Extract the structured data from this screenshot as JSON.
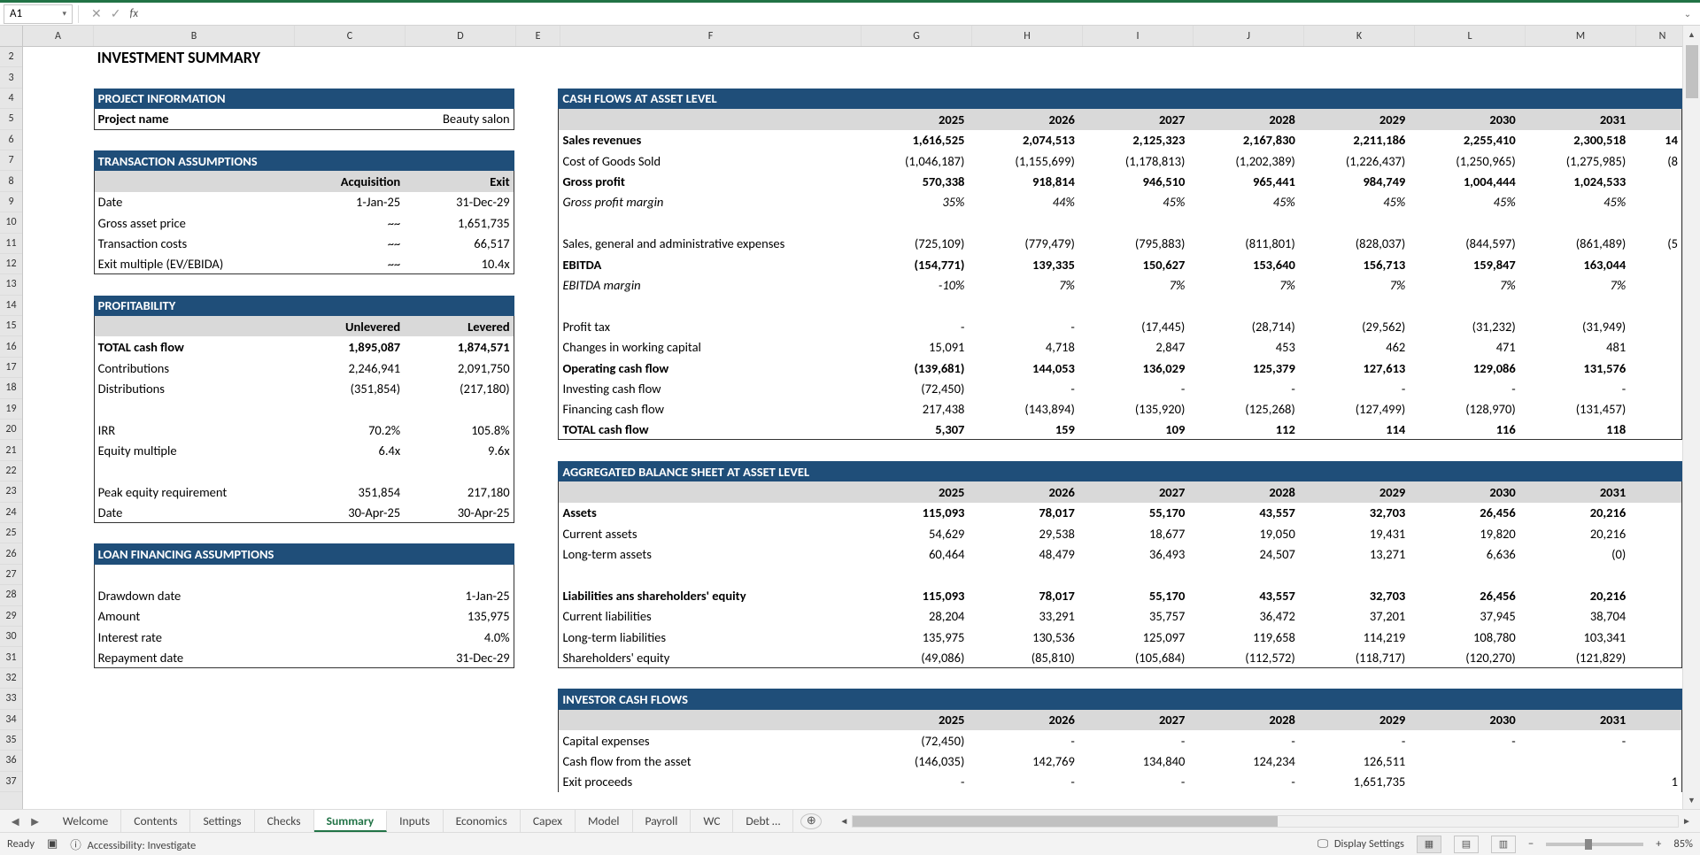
{
  "namebox": "A1",
  "page_title": "INVESTMENT SUMMARY",
  "columns": [
    "A",
    "B",
    "C",
    "D",
    "E",
    "F",
    "G",
    "H",
    "I",
    "J",
    "K",
    "L",
    "M",
    "N"
  ],
  "row_numbers": [
    "2",
    "3",
    "4",
    "5",
    "6",
    "7",
    "8",
    "9",
    "10",
    "11",
    "12",
    "13",
    "14",
    "15",
    "16",
    "17",
    "18",
    "19",
    "20",
    "21",
    "22",
    "23",
    "24",
    "25",
    "26",
    "27",
    "28",
    "29",
    "30",
    "31",
    "32",
    "33",
    "34",
    "35",
    "36",
    "37"
  ],
  "left": {
    "proj_info_hdr": "PROJECT INFORMATION",
    "proj_name_label": "Project name",
    "proj_name_value": "Beauty salon",
    "trans_hdr": "TRANSACTION ASSUMPTIONS",
    "acq_label": "Acquisition",
    "exit_label": "Exit",
    "rows1": [
      {
        "label": "Date",
        "acq": "1-Jan-25",
        "exit": "31-Dec-29"
      },
      {
        "label": "Gross asset price",
        "acq": "~~",
        "exit": "1,651,735"
      },
      {
        "label": "Transaction costs",
        "acq": "~~",
        "exit": "66,517"
      },
      {
        "label": "Exit multiple (EV/EBIDA)",
        "acq": "~~",
        "exit": "10.4x"
      }
    ],
    "profit_hdr": "PROFITABILITY",
    "unlev_label": "Unlevered",
    "lev_label": "Levered",
    "total_cf_label": "TOTAL cash flow",
    "total_cf_u": "1,895,087",
    "total_cf_l": "1,874,571",
    "contrib_label": " Contributions",
    "contrib_u": "2,246,941",
    "contrib_l": "2,091,750",
    "distrib_label": " Distributions",
    "distrib_u": "(351,854)",
    "distrib_l": "(217,180)",
    "irr_label": "IRR",
    "irr_u": "70.2%",
    "irr_l": "105.8%",
    "eqmult_label": "Equity multiple",
    "eqmult_u": "6.4x",
    "eqmult_l": "9.6x",
    "peak_label": "Peak equity requirement",
    "peak_u": "351,854",
    "peak_l": "217,180",
    "peak_date_label": " Date",
    "peak_date_u": "30-Apr-25",
    "peak_date_l": "30-Apr-25",
    "loan_hdr": "LOAN FINANCING ASSUMPTIONS",
    "loan_rows": [
      {
        "label": "Drawdown date",
        "val": "1-Jan-25"
      },
      {
        "label": "Amount",
        "val": "135,975"
      },
      {
        "label": "Interest rate",
        "val": "4.0%"
      },
      {
        "label": "Repayment date",
        "val": "31-Dec-29"
      }
    ]
  },
  "right": {
    "years": [
      "2025",
      "2026",
      "2027",
      "2028",
      "2029",
      "2030",
      "2031"
    ],
    "cf_hdr": "CASH FLOWS AT ASSET LEVEL",
    "lines": [
      {
        "label": "Sales revenues",
        "bold": true,
        "vals": [
          "1,616,525",
          "2,074,513",
          "2,125,323",
          "2,167,830",
          "2,211,186",
          "2,255,410",
          "2,300,518"
        ],
        "tail": "14"
      },
      {
        "label": "  Cost of Goods Sold",
        "vals": [
          "(1,046,187)",
          "(1,155,699)",
          "(1,178,813)",
          "(1,202,389)",
          "(1,226,437)",
          "(1,250,965)",
          "(1,275,985)"
        ],
        "tail": "(8"
      },
      {
        "label": "Gross profit",
        "bold": true,
        "vals": [
          "570,338",
          "918,814",
          "946,510",
          "965,441",
          "984,749",
          "1,004,444",
          "1,024,533"
        ],
        "tail": ""
      },
      {
        "label": "  Gross profit margin",
        "italic": true,
        "vals": [
          "35%",
          "44%",
          "45%",
          "45%",
          "45%",
          "45%",
          "45%"
        ],
        "tail": ""
      },
      {
        "label": "",
        "vals": [
          "",
          "",
          "",
          "",
          "",
          "",
          ""
        ],
        "tail": ""
      },
      {
        "label": "  Sales, general and administrative expenses",
        "vals": [
          "(725,109)",
          "(779,479)",
          "(795,883)",
          "(811,801)",
          "(828,037)",
          "(844,597)",
          "(861,489)"
        ],
        "tail": "(5"
      },
      {
        "label": "EBITDA",
        "bold": true,
        "vals": [
          "(154,771)",
          "139,335",
          "150,627",
          "153,640",
          "156,713",
          "159,847",
          "163,044"
        ],
        "tail": ""
      },
      {
        "label": "  EBITDA margin",
        "italic": true,
        "vals": [
          "-10%",
          "7%",
          "7%",
          "7%",
          "7%",
          "7%",
          "7%"
        ],
        "tail": ""
      },
      {
        "label": "",
        "vals": [
          "",
          "",
          "",
          "",
          "",
          "",
          ""
        ],
        "tail": ""
      },
      {
        "label": "  Profit tax",
        "vals": [
          "-",
          "-",
          "(17,445)",
          "(28,714)",
          "(29,562)",
          "(31,232)",
          "(31,949)"
        ],
        "tail": ""
      },
      {
        "label": "  Changes in working capital",
        "vals": [
          "15,091",
          "4,718",
          "2,847",
          "453",
          "462",
          "471",
          "481"
        ],
        "tail": ""
      },
      {
        "label": "Operating cash flow",
        "bold": true,
        "vals": [
          "(139,681)",
          "144,053",
          "136,029",
          "125,379",
          "127,613",
          "129,086",
          "131,576"
        ],
        "tail": ""
      },
      {
        "label": "  Investing cash flow",
        "vals": [
          "(72,450)",
          "-",
          "-",
          "-",
          "-",
          "-",
          "-"
        ],
        "tail": ""
      },
      {
        "label": "  Financing cash flow",
        "vals": [
          "217,438",
          "(143,894)",
          "(135,920)",
          "(125,268)",
          "(127,499)",
          "(128,970)",
          "(131,457)"
        ],
        "tail": ""
      },
      {
        "label": "TOTAL cash flow",
        "bold": true,
        "vals": [
          "5,307",
          "159",
          "109",
          "112",
          "114",
          "116",
          "118"
        ],
        "tail": ""
      }
    ],
    "bs_hdr": "AGGREGATED BALANCE SHEET AT ASSET LEVEL",
    "bs_lines": [
      {
        "label": "Assets",
        "bold": true,
        "vals": [
          "115,093",
          "78,017",
          "55,170",
          "43,557",
          "32,703",
          "26,456",
          "20,216"
        ]
      },
      {
        "label": "  Current assets",
        "vals": [
          "54,629",
          "29,538",
          "18,677",
          "19,050",
          "19,431",
          "19,820",
          "20,216"
        ]
      },
      {
        "label": "  Long-term assets",
        "vals": [
          "60,464",
          "48,479",
          "36,493",
          "24,507",
          "13,271",
          "6,636",
          "(0)"
        ]
      },
      {
        "label": "",
        "vals": [
          "",
          "",
          "",
          "",
          "",
          "",
          ""
        ]
      },
      {
        "label": "Liabilities ans shareholders' equity",
        "bold": true,
        "vals": [
          "115,093",
          "78,017",
          "55,170",
          "43,557",
          "32,703",
          "26,456",
          "20,216"
        ]
      },
      {
        "label": "  Current liabilities",
        "vals": [
          "28,204",
          "33,291",
          "35,757",
          "36,472",
          "37,201",
          "37,945",
          "38,704"
        ]
      },
      {
        "label": "  Long-term liabilities",
        "vals": [
          "135,975",
          "130,536",
          "125,097",
          "119,658",
          "114,219",
          "108,780",
          "103,341"
        ]
      },
      {
        "label": "  Shareholders' equity",
        "vals": [
          "(49,086)",
          "(85,810)",
          "(105,684)",
          "(112,572)",
          "(118,717)",
          "(120,270)",
          "(121,829)"
        ]
      }
    ],
    "inv_hdr": "INVESTOR CASH FLOWS",
    "inv_lines": [
      {
        "label": "  Capital expenses",
        "vals": [
          "(72,450)",
          "-",
          "-",
          "-",
          "-",
          "-",
          "-"
        ]
      },
      {
        "label": "  Cash flow from the asset",
        "vals": [
          "(146,035)",
          "142,769",
          "134,840",
          "124,234",
          "126,511",
          "",
          ""
        ]
      },
      {
        "label": "  Exit proceeds",
        "vals": [
          "-",
          "-",
          "-",
          "-",
          "1,651,735",
          "",
          ""
        ],
        "tail": "1"
      }
    ]
  },
  "tabs": [
    "Welcome",
    "Contents",
    "Settings",
    "Checks",
    "Summary",
    "Inputs",
    "Economics",
    "Capex",
    "Model",
    "Payroll",
    "WC",
    "Debt …"
  ],
  "active_tab": "Summary",
  "status": {
    "ready": "Ready",
    "acc": "Accessibility: Investigate",
    "display": "Display Settings",
    "zoom": "85%"
  }
}
